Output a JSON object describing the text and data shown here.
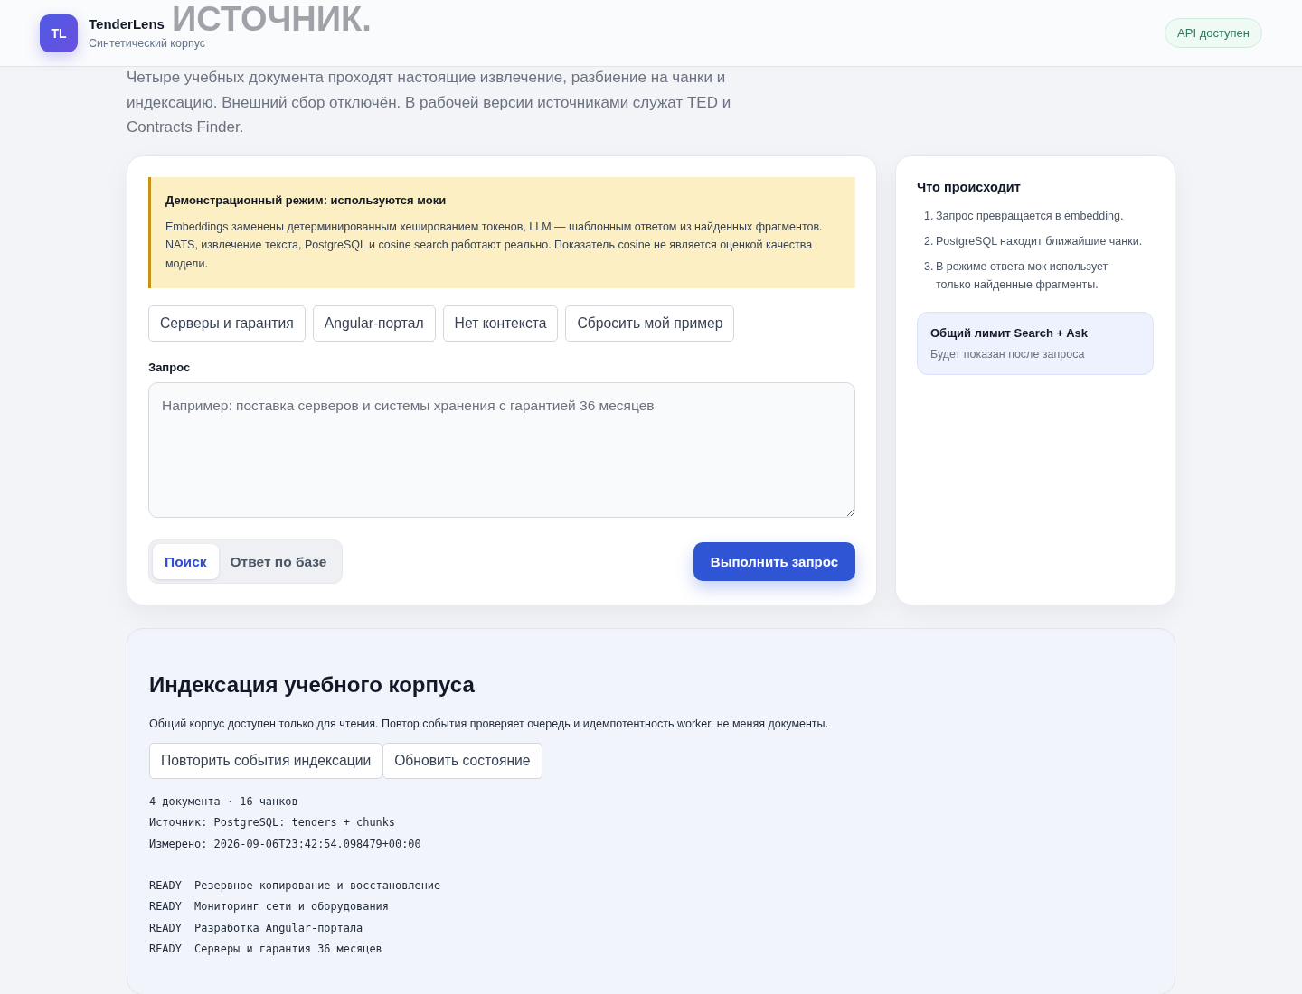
{
  "header": {
    "logo": "TL",
    "name": "TenderLens",
    "subtitle": "Синтетический корпус",
    "status_badge": "API доступен"
  },
  "hero": {
    "title": "ИСТОЧНИК.",
    "intro": "Четыре учебных документа проходят настоящие извлечение, разбиение на чанки и индексацию. Внешний сбор отключён. В рабочей версии источниками служат TED и Contracts Finder."
  },
  "query_panel": {
    "notice": {
      "title": "Демонстрационный режим: используются моки",
      "text": "Embeddings заменены детерминированным хешированием токенов, LLM — шаблонным ответом из найденных фрагментов. NATS, извлечение текста, PostgreSQL и cosine search работают реально. Показатель cosine не является оценкой качества модели."
    },
    "examples": [
      "Серверы и гарантия",
      "Angular-портал",
      "Нет контекста",
      "Сбросить мой пример"
    ],
    "query_field": {
      "label": "Запрос",
      "placeholder": "Например: поставка серверов и системы хранения с гарантией 36 месяцев"
    },
    "modes": [
      {
        "label": "Поиск",
        "selected": true
      },
      {
        "label": "Ответ по базе",
        "selected": false
      }
    ],
    "run_button": "Выполнить запрос"
  },
  "info_panel": {
    "title": "Что происходит",
    "steps": [
      {
        "number": "1.",
        "text": "Запрос превращается в embedding."
      },
      {
        "number": "2.",
        "text": "PostgreSQL находит ближайшие чанки."
      },
      {
        "number": "3.",
        "text": "В режиме ответа мок использует только найденные фрагменты."
      }
    ],
    "limit": {
      "title": "Общий лимит Search + Ask",
      "text": "Будет показан после запроса"
    }
  },
  "index_panel": {
    "title": "Индексация учебного корпуса",
    "description": "Общий корпус доступен только для чтения. Повтор события проверяет очередь и идемпотентность worker, не меняя документы.",
    "buttons": [
      "Повторить события индексации",
      "Обновить состояние"
    ],
    "summary": [
      "4 документа · 16 чанков",
      "Источник: PostgreSQL: tenders + chunks",
      "Измерено: 2026-09-06T23:42:54.098479+00:00"
    ],
    "documents": [
      {
        "status": "READY",
        "title": "Резервное копирование и восстановление"
      },
      {
        "status": "READY",
        "title": "Мониторинг сети и оборудования"
      },
      {
        "status": "READY",
        "title": "Разработка Angular-портала"
      },
      {
        "status": "READY",
        "title": "Серверы и гарантия 36 месяцев"
      }
    ]
  }
}
